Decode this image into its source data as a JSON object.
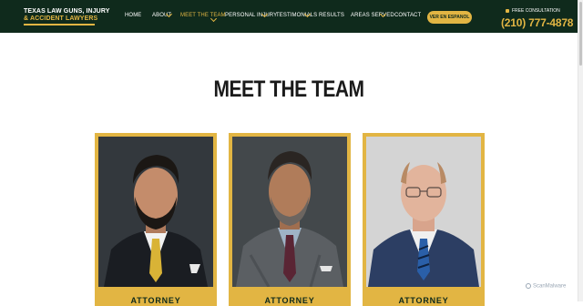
{
  "logo": {
    "line1": "TEXAS LAW GUNS, INJURY",
    "line2": "& ACCIDENT LAWYERS"
  },
  "nav": [
    {
      "label": "HOME",
      "dropdown": false,
      "active": false
    },
    {
      "label": "ABOUT",
      "dropdown": true,
      "active": false
    },
    {
      "label": "MEET THE TEAM",
      "dropdown": true,
      "active": true
    },
    {
      "label": "PERSONAL INJURY",
      "dropdown": true,
      "active": false
    },
    {
      "label": "TESTIMONIALS",
      "dropdown": true,
      "active": false
    },
    {
      "label": "RESULTS",
      "dropdown": false,
      "active": false
    },
    {
      "label": "AREAS SERVED",
      "dropdown": true,
      "active": false
    },
    {
      "label": "CONTACT",
      "dropdown": false,
      "active": false
    }
  ],
  "cta": {
    "label": "VER EN ESPANOL"
  },
  "contact": {
    "consult_label": "FREE CONSULTATION",
    "phone": "(210) 777-4878",
    "phone_icon": "phone-icon"
  },
  "page": {
    "title": "MEET THE TEAM"
  },
  "team": [
    {
      "name": "ATTORNEY",
      "photo": "attorney-photo-1"
    },
    {
      "name": "ATTORNEY",
      "photo": "attorney-photo-2"
    },
    {
      "name": "ATTORNEY",
      "photo": "attorney-photo-3"
    }
  ],
  "watermark": {
    "text": "ScanMalware"
  },
  "colors": {
    "header_bg": "#0f2a1c",
    "accent_gold": "#e2b543",
    "title_text": "#1a1a1a"
  }
}
